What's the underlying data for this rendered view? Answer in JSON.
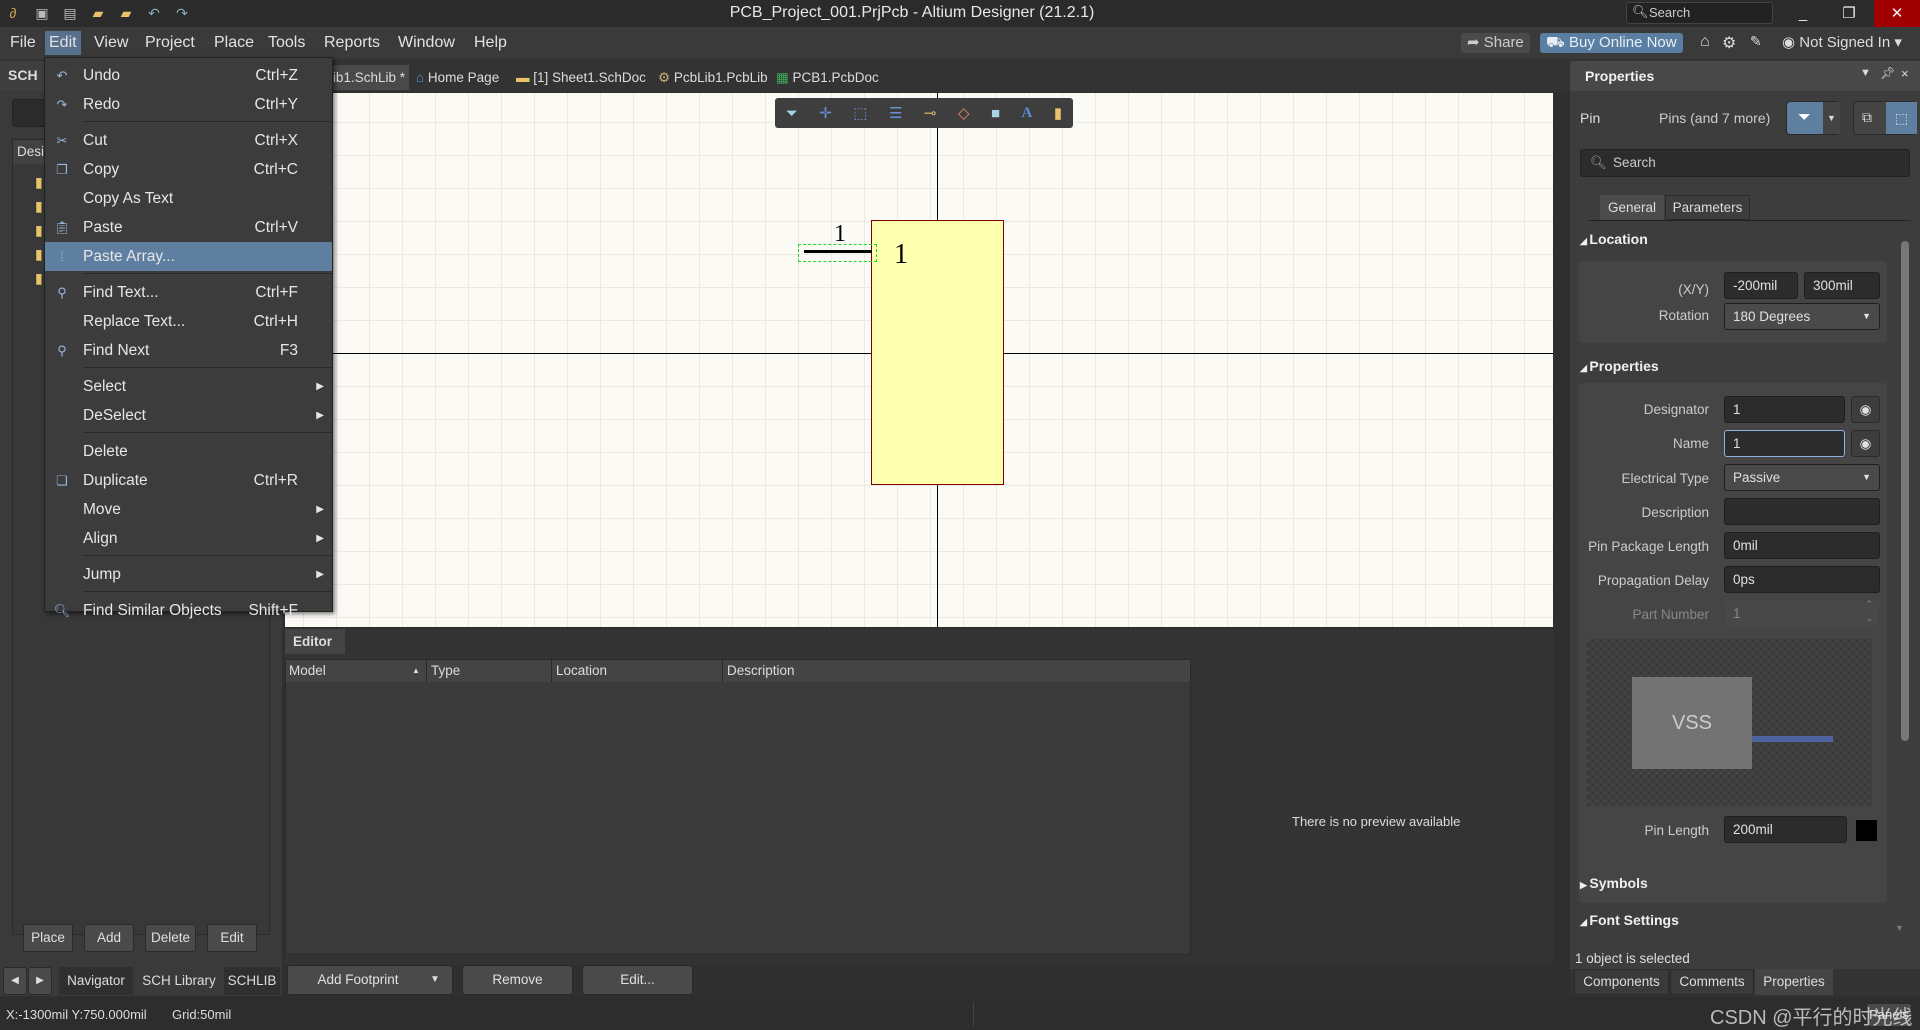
{
  "titlebar": {
    "title": "PCB_Project_001.PrjPcb - Altium Designer (21.2.1)",
    "search_placeholder": "Search",
    "minimize": "_",
    "restore": "❐",
    "close": "✕"
  },
  "menubar": {
    "items": [
      "File",
      "Edit",
      "View",
      "Project",
      "Place",
      "Tools",
      "Reports",
      "Window",
      "Help"
    ],
    "share": "Share",
    "buy": "Buy Online Now",
    "user": "Not Signed In"
  },
  "doc_tabs": [
    "ib1.SchLib *",
    "Home Page",
    "[1] Sheet1.SchDoc",
    "PcbLib1.PcbLib",
    "PCB1.PcbDoc"
  ],
  "left_panel": {
    "title": "SCH",
    "column": "Desi",
    "buttons": [
      "Place",
      "Add",
      "Delete",
      "Edit"
    ],
    "tabs": [
      "Navigator",
      "SCH Library",
      "SCHLIB"
    ]
  },
  "edit_menu": {
    "items": [
      {
        "label": "Undo",
        "shortcut": "Ctrl+Z",
        "icon": "undo-icon"
      },
      {
        "label": "Redo",
        "shortcut": "Ctrl+Y",
        "icon": "redo-icon"
      },
      {
        "label": "Cut",
        "shortcut": "Ctrl+X",
        "icon": "scissors-icon"
      },
      {
        "label": "Copy",
        "shortcut": "Ctrl+C",
        "icon": "copy-icon"
      },
      {
        "label": "Copy As Text",
        "shortcut": ""
      },
      {
        "label": "Paste",
        "shortcut": "Ctrl+V",
        "icon": "paste-icon"
      },
      {
        "label": "Paste Array...",
        "shortcut": "",
        "icon": "paste-array-icon"
      },
      {
        "label": "Find Text...",
        "shortcut": "Ctrl+F",
        "icon": "binoculars-icon"
      },
      {
        "label": "Replace Text...",
        "shortcut": "Ctrl+H"
      },
      {
        "label": "Find Next",
        "shortcut": "F3",
        "icon": "find-next-icon"
      },
      {
        "label": "Select",
        "shortcut": ""
      },
      {
        "label": "DeSelect",
        "shortcut": ""
      },
      {
        "label": "Delete",
        "shortcut": ""
      },
      {
        "label": "Duplicate",
        "shortcut": "Ctrl+R",
        "icon": "duplicate-icon"
      },
      {
        "label": "Move",
        "shortcut": ""
      },
      {
        "label": "Align",
        "shortcut": ""
      },
      {
        "label": "Jump",
        "shortcut": ""
      },
      {
        "label": "Find Similar Objects",
        "shortcut": "Shift+F",
        "icon": "magnifier-icon"
      }
    ]
  },
  "canvas": {
    "pin_designator": "1",
    "pin_name": "1",
    "body_color": "#ffffb0",
    "border_color": "#800000"
  },
  "editor": {
    "tab": "Editor",
    "columns": [
      "Model",
      "Type",
      "Location",
      "Description"
    ],
    "no_preview": "There is no preview available",
    "buttons": {
      "add_footprint": "Add Footprint",
      "remove": "Remove",
      "edit": "Edit..."
    }
  },
  "properties": {
    "title": "Properties",
    "object": "Pin",
    "filter": "Pins (and 7 more)",
    "search_placeholder": "Search",
    "tabs": [
      "General",
      "Parameters"
    ],
    "location": {
      "title": "Location",
      "xy_label": "(X/Y)",
      "x": "-200mil",
      "y": "300mil",
      "rotation_label": "Rotation",
      "rotation": "180 Degrees"
    },
    "props": {
      "title": "Properties",
      "designator_label": "Designator",
      "designator": "1",
      "name_label": "Name",
      "name": "1",
      "etype_label": "Electrical Type",
      "etype": "Passive",
      "desc_label": "Description",
      "desc": "",
      "ppl_label": "Pin Package Length",
      "ppl": "0mil",
      "pd_label": "Propagation Delay",
      "pd": "0ps",
      "pn_label": "Part Number",
      "pn": "1",
      "preview_text": "VSS",
      "pin_length_label": "Pin Length",
      "pin_length": "200mil"
    },
    "symbols": "Symbols",
    "font_settings": "Font Settings",
    "selected": "1 object is selected",
    "bottom_tabs": [
      "Components",
      "Comments",
      "Properties"
    ]
  },
  "status": {
    "coords": "X:-1300mil Y:750.000mil",
    "grid": "Grid:50mil",
    "panels": "Panels"
  },
  "watermark": "CSDN @平行的时光线",
  "accent": "#5e7fa0"
}
